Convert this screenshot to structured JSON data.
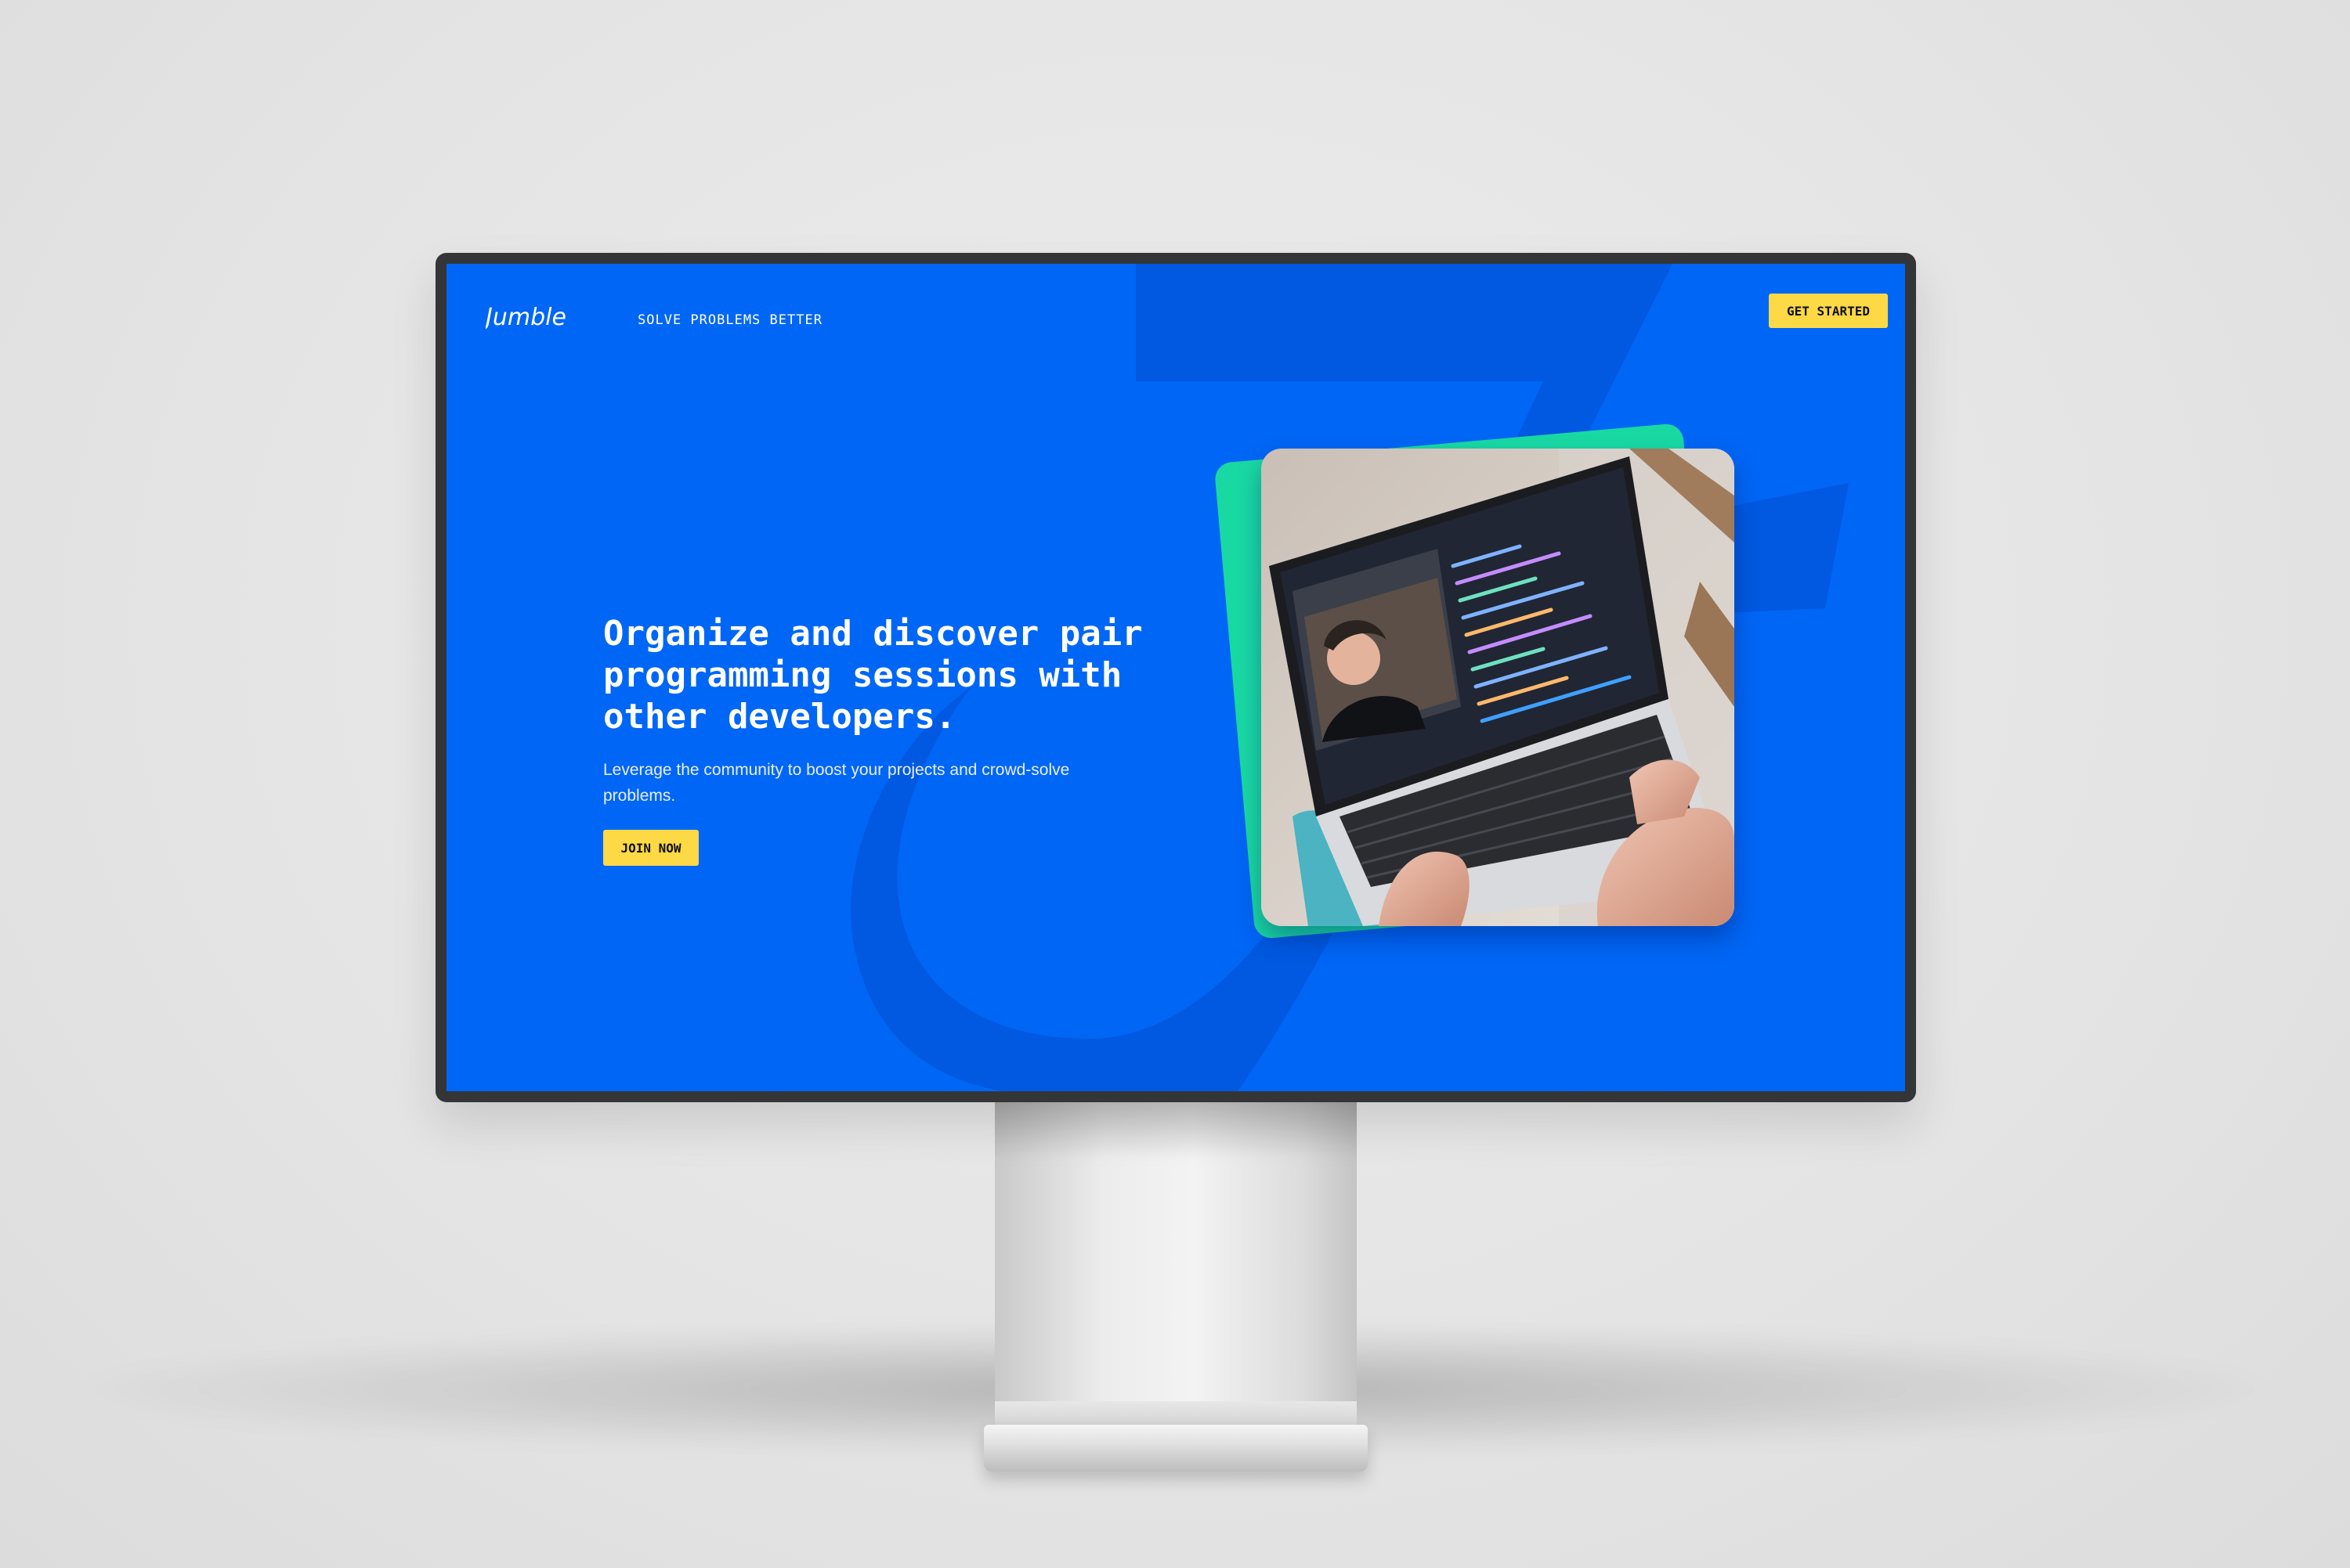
{
  "nav": {
    "logo_text": "Jumble",
    "tagline": "SOLVE PROBLEMS BETTER",
    "cta_label": "GET STARTED"
  },
  "hero": {
    "title": "Organize and discover pair programming sessions with other developers.",
    "subtitle": "Leverage the community to boost your projects and crowd-solve problems.",
    "cta_label": "JOIN NOW"
  },
  "photo": {
    "icon": "laptop-video-call-photo"
  },
  "colors": {
    "brand_blue": "#0066f5",
    "accent_yellow": "#fcd945",
    "accent_green": "#19d9a3",
    "bezel": "#333537"
  }
}
